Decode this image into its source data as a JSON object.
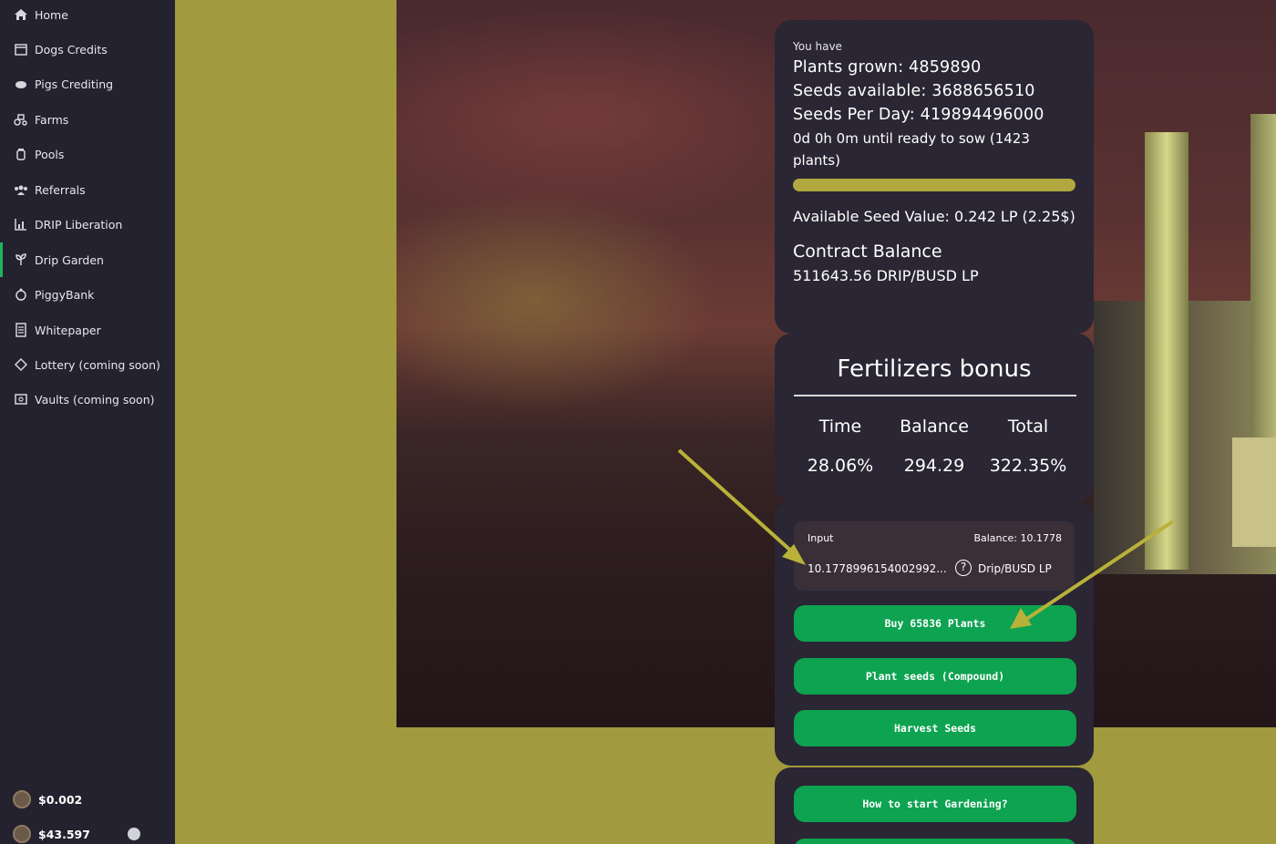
{
  "sidebar": {
    "items": [
      {
        "label": "Home",
        "icon": "home-icon"
      },
      {
        "label": "Dogs Credits",
        "icon": "store-icon"
      },
      {
        "label": "Pigs Crediting",
        "icon": "piggy-icon"
      },
      {
        "label": "Farms",
        "icon": "tractor-icon"
      },
      {
        "label": "Pools",
        "icon": "jar-icon"
      },
      {
        "label": "Referrals",
        "icon": "users-icon"
      },
      {
        "label": "DRIP Liberation",
        "icon": "chart-icon"
      },
      {
        "label": "Drip Garden",
        "icon": "seedling-icon"
      },
      {
        "label": "PiggyBank",
        "icon": "piggybank-icon"
      },
      {
        "label": "Whitepaper",
        "icon": "document-icon"
      },
      {
        "label": "Lottery (coming soon)",
        "icon": "ticket-icon"
      },
      {
        "label": "Vaults (coming soon)",
        "icon": "vault-icon"
      }
    ],
    "prices": [
      {
        "label": "$0.002",
        "icon": "coin-icon"
      },
      {
        "label": "$43.597",
        "icon": "coin-icon"
      }
    ]
  },
  "stats": {
    "you_have": "You have",
    "plants_grown": "Plants grown: 4859890",
    "seeds_available": "Seeds available: 3688656510",
    "seeds_per_day": "Seeds Per Day: 419894496000",
    "until_ready": "0d 0h 0m until ready to sow (1423 plants)",
    "sow_progress": 1.0,
    "seed_value": "Available Seed Value: 0.242 LP (2.25$)",
    "contract_title": "Contract Balance",
    "contract_value": "511643.56 DRIP/BUSD LP"
  },
  "fertilizers": {
    "title": "Fertilizers bonus",
    "columns": [
      {
        "head": "Time",
        "value": "28.06%"
      },
      {
        "head": "Balance",
        "value": "294.29"
      },
      {
        "head": "Total",
        "value": "322.35%"
      }
    ]
  },
  "input": {
    "label": "Input",
    "balance": "Balance: 10.1778",
    "value": "10.1778996154002992...",
    "token": "Drip/BUSD LP"
  },
  "buttons": {
    "buy": "Buy 65836 Plants",
    "compound": "Plant seeds (Compound)",
    "harvest": "Harvest Seeds",
    "how_to": "How to start Gardening?"
  },
  "colors": {
    "accent_green": "#0da350",
    "olive": "#a19a3e",
    "sidebar": "#25222f",
    "card": "#2a2633"
  }
}
